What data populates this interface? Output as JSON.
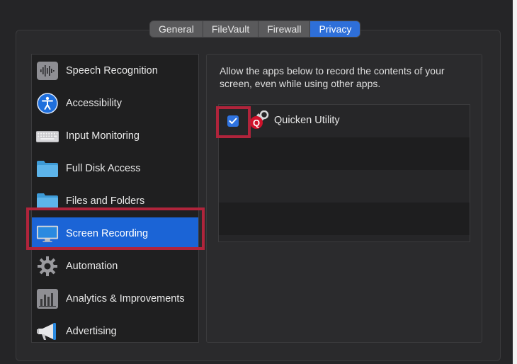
{
  "tabs": [
    {
      "label": "General",
      "active": false
    },
    {
      "label": "FileVault",
      "active": false
    },
    {
      "label": "Firewall",
      "active": false
    },
    {
      "label": "Privacy",
      "active": true
    }
  ],
  "sidebar": {
    "items": [
      {
        "label": "Speech Recognition",
        "icon": "waveform-icon",
        "selected": false
      },
      {
        "label": "Accessibility",
        "icon": "accessibility-icon",
        "selected": false
      },
      {
        "label": "Input Monitoring",
        "icon": "keyboard-icon",
        "selected": false
      },
      {
        "label": "Full Disk Access",
        "icon": "folder-icon",
        "selected": false
      },
      {
        "label": "Files and Folders",
        "icon": "folder-icon",
        "selected": false
      },
      {
        "label": "Screen Recording",
        "icon": "display-icon",
        "selected": true
      },
      {
        "label": "Automation",
        "icon": "gear-icon",
        "selected": false
      },
      {
        "label": "Analytics & Improvements",
        "icon": "bar-chart-icon",
        "selected": false
      },
      {
        "label": "Advertising",
        "icon": "megaphone-icon",
        "selected": false
      }
    ]
  },
  "content": {
    "description": "Allow the apps below to record the contents of your screen, even while using other apps.",
    "apps": [
      {
        "name": "Quicken Utility",
        "checked": true,
        "icon": "quicken-utility-icon"
      }
    ]
  },
  "colors": {
    "accent": "#1b64d6",
    "highlight_box": "#b0243b"
  }
}
